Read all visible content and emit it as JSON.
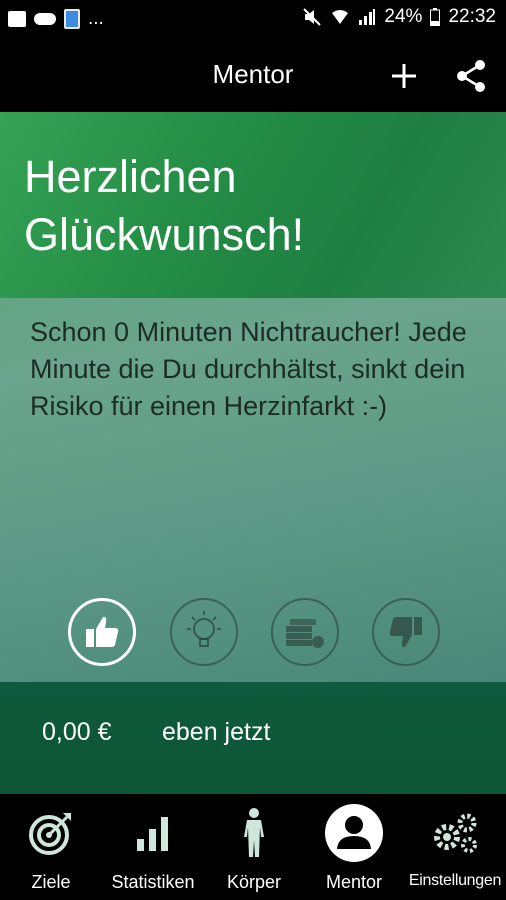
{
  "status_bar": {
    "icons_left": [
      "image-icon",
      "cloud-icon",
      "app-icon"
    ],
    "more": "...",
    "icons_right": [
      "mute-icon",
      "wifi-icon",
      "signal-icon",
      "battery-icon"
    ],
    "battery": "24%",
    "time": "22:32"
  },
  "appbar": {
    "title": "Mentor",
    "actions": [
      "plus-icon",
      "share-icon"
    ]
  },
  "main": {
    "headline": "Herzlichen Glückwunsch!",
    "message": "Schon 0 Minuten Nichtraucher! Jede Minute die Du durchhältst, sinkt dein Risiko für einen Herzinfarkt :-)",
    "actions": [
      {
        "icon": "thumbs-up-icon",
        "active": true
      },
      {
        "icon": "lightbulb-icon",
        "active": false
      },
      {
        "icon": "money-icon",
        "active": false
      },
      {
        "icon": "thumbs-down-icon",
        "active": false
      }
    ],
    "amount": "0,00 €",
    "time_label": "eben jetzt"
  },
  "bottom_nav": {
    "items": [
      {
        "label": "Ziele",
        "icon": "target-icon"
      },
      {
        "label": "Statistiken",
        "icon": "bar-chart-icon"
      },
      {
        "label": "Körper",
        "icon": "body-icon"
      },
      {
        "label": "Mentor",
        "icon": "mentor-avatar-icon",
        "selected": true
      },
      {
        "label": "Einstellungen",
        "icon": "gears-icon"
      }
    ]
  },
  "colors": {
    "header_green": "#238d45",
    "footer_green": "#0e5537",
    "message_text": "#1c2c25"
  }
}
